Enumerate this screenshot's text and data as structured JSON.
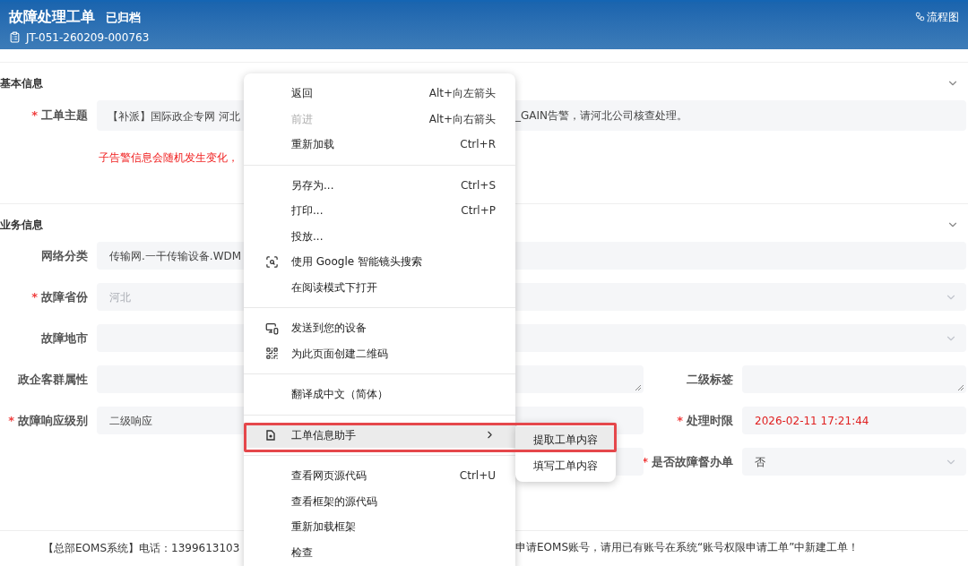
{
  "header": {
    "title": "故障处理工单",
    "status": "已归档",
    "ticket_id": "JT-051-260209-000763",
    "flow_button": "流程图"
  },
  "sections": [
    {
      "title": "基本信息",
      "expanded": true,
      "rows": [
        {
          "cells": [
            {
              "label": "工单主题",
              "required_mark": "*",
              "value_parts": [
                "【补派】国际政企专网 河北 ",
                "_GAIN告警，请河北公司核查处理。"
              ]
            }
          ]
        }
      ],
      "note": "子告警信息会随机发生变化，"
    },
    {
      "title": "业务信息",
      "expanded": true,
      "rows": [
        {
          "cells": [
            {
              "label": "网络分类",
              "value": "传输网.一干传输设备.WDM",
              "dropdown": false
            }
          ]
        },
        {
          "cells": [
            {
              "label": "故障省份",
              "required_mark": "*",
              "value": "河北",
              "disabled": true,
              "dropdown": true
            }
          ]
        },
        {
          "cells": [
            {
              "label": "故障地市",
              "dropdown": true
            }
          ]
        },
        {
          "cells": [
            {
              "label": "政企客群属性",
              "resizable": true
            },
            {
              "label": "二级标签",
              "resizable": true
            }
          ]
        },
        {
          "cells": [
            {
              "label": "故障响应级别",
              "required_mark": "*",
              "value": "二级响应"
            },
            {
              "label": "处理时限",
              "required_mark": "*",
              "value": "2026-02-11 17:21:44",
              "highlighted": true
            }
          ]
        },
        {
          "cells": [
            {
              "dropdown": false
            },
            {
              "label": "是否故障督办单",
              "required_mark": "*",
              "value": "否",
              "dropdown": true
            }
          ]
        }
      ]
    }
  ],
  "footer": {
    "text_parts": [
      "【总部EOMS系统】电话：1399613103",
      "申请EOMS账号，请用已有账号在系统“账号权限申请工单”中新建工单！"
    ]
  },
  "context_menu": {
    "items": [
      {
        "kind": "item",
        "label": "返回",
        "shortcut": "Alt+向左箭头",
        "disabled": false,
        "highlighted": false
      },
      {
        "kind": "item",
        "label": "前进",
        "shortcut": "Alt+向右箭头",
        "disabled": true,
        "highlighted": false
      },
      {
        "kind": "item",
        "label": "重新加载",
        "shortcut": "Ctrl+R",
        "disabled": false,
        "highlighted": false
      },
      {
        "kind": "separator"
      },
      {
        "kind": "item",
        "label": "另存为...",
        "shortcut": "Ctrl+S",
        "disabled": false,
        "highlighted": false
      },
      {
        "kind": "item",
        "label": "打印...",
        "shortcut": "Ctrl+P",
        "disabled": false,
        "highlighted": false
      },
      {
        "kind": "item",
        "label": "投放...",
        "disabled": false,
        "highlighted": false
      },
      {
        "kind": "item",
        "label": "使用 Google 智能镜头搜索",
        "disabled": false,
        "highlighted": false
      },
      {
        "kind": "item",
        "label": "在阅读模式下打开",
        "disabled": false,
        "highlighted": false
      },
      {
        "kind": "separator"
      },
      {
        "kind": "item",
        "label": "发送到您的设备",
        "disabled": false,
        "highlighted": false
      },
      {
        "kind": "item",
        "label": "为此页面创建二维码",
        "disabled": false,
        "highlighted": false
      },
      {
        "kind": "separator"
      },
      {
        "kind": "item",
        "label": "翻译成中文（简体）",
        "disabled": false,
        "highlighted": false
      },
      {
        "kind": "separator"
      },
      {
        "kind": "item",
        "label": "工单信息助手",
        "submenu": true,
        "disabled": false,
        "highlighted": true
      },
      {
        "kind": "separator"
      },
      {
        "kind": "item",
        "label": "查看网页源代码",
        "shortcut": "Ctrl+U",
        "disabled": false,
        "highlighted": false
      },
      {
        "kind": "item",
        "label": "查看框架的源代码",
        "disabled": false,
        "highlighted": false
      },
      {
        "kind": "item",
        "label": "重新加载框架",
        "disabled": false,
        "highlighted": false
      },
      {
        "kind": "item",
        "label": "检查",
        "disabled": false,
        "highlighted": false
      }
    ],
    "submenu": [
      {
        "label": "提取工单内容",
        "highlighted": true
      },
      {
        "label": "填写工单内容",
        "highlighted": false
      }
    ]
  }
}
